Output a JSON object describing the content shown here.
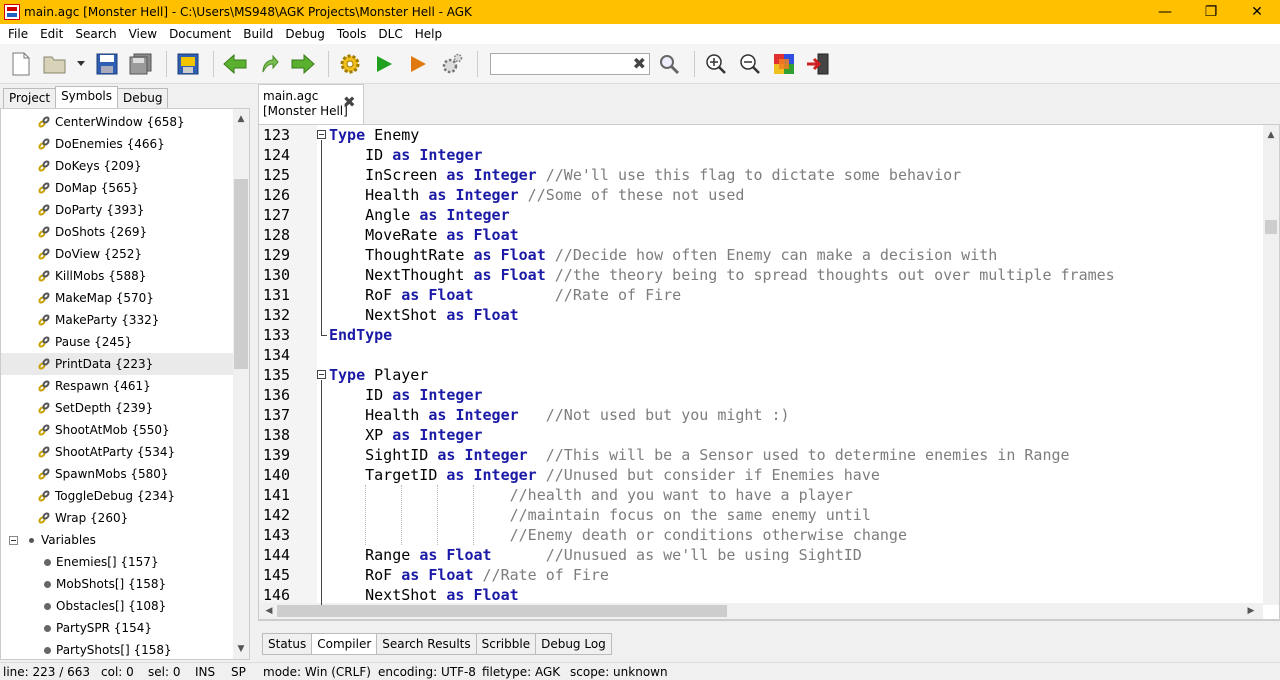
{
  "window": {
    "title": "main.agc [Monster Hell] - C:\\Users\\MS948\\AGK Projects\\Monster Hell - AGK",
    "minimize": "—",
    "maximize": "❐",
    "close": "✕"
  },
  "menu": [
    "File",
    "Edit",
    "Search",
    "View",
    "Document",
    "Build",
    "Debug",
    "Tools",
    "DLC",
    "Help"
  ],
  "toolbar": {
    "search_value": "",
    "clear": "✖"
  },
  "left_tabs": [
    "Project",
    "Symbols",
    "Debug"
  ],
  "symbols": {
    "functions": [
      "CenterWindow {658}",
      "DoEnemies {466}",
      "DoKeys {209}",
      "DoMap {565}",
      "DoParty {393}",
      "DoShots {269}",
      "DoView {252}",
      "KillMobs {588}",
      "MakeMap {570}",
      "MakeParty {332}",
      "Pause {245}",
      "PrintData {223}",
      "Respawn {461}",
      "SetDepth {239}",
      "ShootAtMob {550}",
      "ShootAtParty {534}",
      "SpawnMobs {580}",
      "ToggleDebug {234}",
      "Wrap {260}"
    ],
    "group_label": "Variables",
    "variables": [
      "Enemies[] {157}",
      "MobShots[] {158}",
      "Obstacles[] {108}",
      "PartySPR {154}",
      "PartyShots[] {158}"
    ]
  },
  "editor_tab": {
    "line1": "main.agc",
    "line2": "[Monster Hell]",
    "close": "✖"
  },
  "code": [
    {
      "n": "123",
      "t": [
        {
          "k": "kw",
          "s": "Type"
        },
        {
          "k": "",
          "s": " Enemy"
        }
      ]
    },
    {
      "n": "124",
      "t": [
        {
          "k": "",
          "s": "    ID "
        },
        {
          "k": "kw",
          "s": "as"
        },
        {
          "k": "",
          "s": " "
        },
        {
          "k": "kw",
          "s": "Integer"
        }
      ]
    },
    {
      "n": "125",
      "t": [
        {
          "k": "",
          "s": "    InScreen "
        },
        {
          "k": "kw",
          "s": "as"
        },
        {
          "k": "",
          "s": " "
        },
        {
          "k": "kw",
          "s": "Integer"
        },
        {
          "k": "cm",
          "s": " //We'll use this flag to dictate some behavior"
        }
      ]
    },
    {
      "n": "126",
      "t": [
        {
          "k": "",
          "s": "    Health "
        },
        {
          "k": "kw",
          "s": "as"
        },
        {
          "k": "",
          "s": " "
        },
        {
          "k": "kw",
          "s": "Integer"
        },
        {
          "k": "cm",
          "s": " //Some of these not used"
        }
      ]
    },
    {
      "n": "127",
      "t": [
        {
          "k": "",
          "s": "    Angle "
        },
        {
          "k": "kw",
          "s": "as"
        },
        {
          "k": "",
          "s": " "
        },
        {
          "k": "kw",
          "s": "Integer"
        }
      ]
    },
    {
      "n": "128",
      "t": [
        {
          "k": "",
          "s": "    MoveRate "
        },
        {
          "k": "kw",
          "s": "as"
        },
        {
          "k": "",
          "s": " "
        },
        {
          "k": "kw",
          "s": "Float"
        }
      ]
    },
    {
      "n": "129",
      "t": [
        {
          "k": "",
          "s": "    ThoughtRate "
        },
        {
          "k": "kw",
          "s": "as"
        },
        {
          "k": "",
          "s": " "
        },
        {
          "k": "kw",
          "s": "Float"
        },
        {
          "k": "cm",
          "s": " //Decide how often Enemy can make a decision with"
        }
      ]
    },
    {
      "n": "130",
      "t": [
        {
          "k": "",
          "s": "    NextThought "
        },
        {
          "k": "kw",
          "s": "as"
        },
        {
          "k": "",
          "s": " "
        },
        {
          "k": "kw",
          "s": "Float"
        },
        {
          "k": "cm",
          "s": " //the theory being to spread thoughts out over multiple frames"
        }
      ]
    },
    {
      "n": "131",
      "t": [
        {
          "k": "",
          "s": "    RoF "
        },
        {
          "k": "kw",
          "s": "as"
        },
        {
          "k": "",
          "s": " "
        },
        {
          "k": "kw",
          "s": "Float"
        },
        {
          "k": "cm",
          "s": "         //Rate of Fire"
        }
      ]
    },
    {
      "n": "132",
      "t": [
        {
          "k": "",
          "s": "    NextShot "
        },
        {
          "k": "kw",
          "s": "as"
        },
        {
          "k": "",
          "s": " "
        },
        {
          "k": "kw",
          "s": "Float"
        }
      ]
    },
    {
      "n": "133",
      "t": [
        {
          "k": "kw",
          "s": "EndType"
        }
      ]
    },
    {
      "n": "134",
      "t": []
    },
    {
      "n": "135",
      "t": [
        {
          "k": "kw",
          "s": "Type"
        },
        {
          "k": "",
          "s": " Player"
        }
      ]
    },
    {
      "n": "136",
      "t": [
        {
          "k": "",
          "s": "    ID "
        },
        {
          "k": "kw",
          "s": "as"
        },
        {
          "k": "",
          "s": " "
        },
        {
          "k": "kw",
          "s": "Integer"
        }
      ]
    },
    {
      "n": "137",
      "t": [
        {
          "k": "",
          "s": "    Health "
        },
        {
          "k": "kw",
          "s": "as"
        },
        {
          "k": "",
          "s": " "
        },
        {
          "k": "kw",
          "s": "Integer"
        },
        {
          "k": "cm",
          "s": "   //Not used but you might :)"
        }
      ]
    },
    {
      "n": "138",
      "t": [
        {
          "k": "",
          "s": "    XP "
        },
        {
          "k": "kw",
          "s": "as"
        },
        {
          "k": "",
          "s": " "
        },
        {
          "k": "kw",
          "s": "Integer"
        }
      ]
    },
    {
      "n": "139",
      "t": [
        {
          "k": "",
          "s": "    SightID "
        },
        {
          "k": "kw",
          "s": "as"
        },
        {
          "k": "",
          "s": " "
        },
        {
          "k": "kw",
          "s": "Integer"
        },
        {
          "k": "cm",
          "s": "  //This will be a Sensor used to determine enemies in Range"
        }
      ]
    },
    {
      "n": "140",
      "t": [
        {
          "k": "",
          "s": "    TargetID "
        },
        {
          "k": "kw",
          "s": "as"
        },
        {
          "k": "",
          "s": " "
        },
        {
          "k": "kw",
          "s": "Integer"
        },
        {
          "k": "cm",
          "s": " //Unused but consider if Enemies have"
        }
      ]
    },
    {
      "n": "141",
      "t": [
        {
          "k": "cm",
          "s": "                    //health and you want to have a player"
        }
      ]
    },
    {
      "n": "142",
      "t": [
        {
          "k": "cm",
          "s": "                    //maintain focus on the same enemy until"
        }
      ]
    },
    {
      "n": "143",
      "t": [
        {
          "k": "cm",
          "s": "                    //Enemy death or conditions otherwise change"
        }
      ]
    },
    {
      "n": "144",
      "t": [
        {
          "k": "",
          "s": "    Range "
        },
        {
          "k": "kw",
          "s": "as"
        },
        {
          "k": "",
          "s": " "
        },
        {
          "k": "kw",
          "s": "Float"
        },
        {
          "k": "cm",
          "s": "      //Unusued as we'll be using SightID"
        }
      ]
    },
    {
      "n": "145",
      "t": [
        {
          "k": "",
          "s": "    RoF "
        },
        {
          "k": "kw",
          "s": "as"
        },
        {
          "k": "",
          "s": " "
        },
        {
          "k": "kw",
          "s": "Float"
        },
        {
          "k": "cm",
          "s": " //Rate of Fire"
        }
      ]
    },
    {
      "n": "146",
      "t": [
        {
          "k": "",
          "s": "    NextShot "
        },
        {
          "k": "kw",
          "s": "as"
        },
        {
          "k": "",
          "s": " "
        },
        {
          "k": "kw",
          "s": "Float"
        }
      ]
    }
  ],
  "bottom_tabs": [
    "Status",
    "Compiler",
    "Search Results",
    "Scribble",
    "Debug Log"
  ],
  "statusbar": {
    "line": "line: 223 / 663",
    "col": "col: 0",
    "sel": "sel: 0",
    "ins": "INS",
    "sp": "SP",
    "mode": "mode: Win (CRLF)",
    "encoding": "encoding: UTF-8",
    "filetype": "filetype: AGK",
    "scope": "scope: unknown"
  },
  "colors": {
    "titlebar": "#ffc000",
    "keyword": "#1a1aa6",
    "comment": "#7d7d7d"
  }
}
